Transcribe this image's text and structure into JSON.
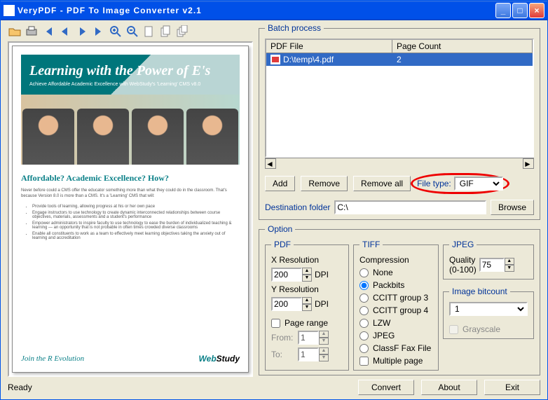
{
  "window": {
    "title": "VeryPDF - PDF To Image Converter v2.1"
  },
  "toolbar_icons": [
    "open",
    "print",
    "first",
    "prev",
    "go",
    "next",
    "last",
    "zoom-in",
    "zoom-out",
    "page-blank",
    "page-copy",
    "page-stack"
  ],
  "preview": {
    "hero_title": "Learning with the Power of E's",
    "hero_sub": "Achieve Affordable Academic Excellence with WebStudy's 'Learning' CMS v8.0",
    "h2": "Affordable? Academic Excellence? How?",
    "body": "Never before could a CMS offer the educator something more than what they could do in the classroom. That's because Version 8.0 is more than a CMS. It's a 'Learning' CMS that will:",
    "b1": "Provide tools of learning, allowing progress at his or her own pace",
    "b2": "Engage instructors to use technology to create dynamic interconnected relationships between course objectives, materials, assessments and a student's performance",
    "b3": "Empower administrators to inspire faculty to use technology to ease the burden of individualized teaching & learning — an opportunity that is not probable in often times crowded diverse classrooms",
    "b4": "Enable all constituents to work as a team to effectively meet learning objectives taking the anxiety out of learning and accreditation",
    "join": "Join the R Evolution",
    "logo_a": "Web",
    "logo_b": "Study"
  },
  "batch": {
    "legend": "Batch process",
    "col1": "PDF File",
    "col2": "Page Count",
    "row_file": "D:\\temp\\4.pdf",
    "row_count": "2",
    "add": "Add",
    "remove": "Remove",
    "removeall": "Remove all",
    "filetype_label": "File type:",
    "filetype_value": "GIF",
    "dest_label": "Destination folder",
    "dest_value": "C:\\",
    "browse": "Browse"
  },
  "option": {
    "legend": "Option",
    "pdf": {
      "legend": "PDF",
      "xres": "X Resolution",
      "yres": "Y Resolution",
      "xval": "200",
      "yval": "200",
      "dpi": "DPI",
      "pagerange": "Page range",
      "from": "From:",
      "to": "To:",
      "from_v": "1",
      "to_v": "1"
    },
    "tiff": {
      "legend": "TIFF",
      "compression": "Compression",
      "none": "None",
      "packbits": "Packbits",
      "cg3": "CCITT group 3",
      "cg4": "CCITT group 4",
      "lzw": "LZW",
      "jpeg": "JPEG",
      "fax": "ClassF Fax File",
      "multipage": "Multiple page"
    },
    "jpeg": {
      "legend": "JPEG",
      "quality": "Quality\n(0-100)",
      "qval": "75"
    },
    "bitcount": {
      "legend": "Image bitcount",
      "value": "1",
      "grayscale": "Grayscale"
    }
  },
  "bottom": {
    "status": "Ready",
    "convert": "Convert",
    "about": "About",
    "exit": "Exit"
  }
}
